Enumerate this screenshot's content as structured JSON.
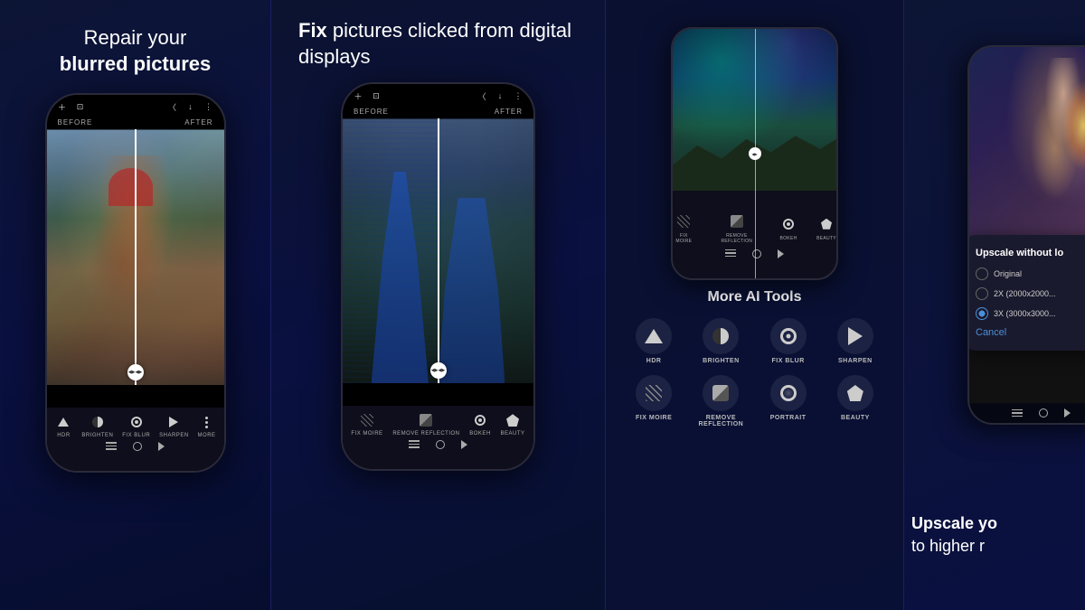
{
  "sections": {
    "section1": {
      "heading_line1": "Repair your",
      "heading_line2": "blurred pictures",
      "before_label": "BEFORE",
      "after_label": "AFTER",
      "tools": [
        "HDR",
        "BRIGHTEN",
        "FIX BLUR",
        "SHARPEN",
        "MORE"
      ]
    },
    "section2": {
      "heading_bold": "Fix",
      "heading_rest": " pictures clicked from digital displays",
      "before_label": "BEFORE",
      "after_label": "AFTER",
      "tools": [
        "FIX MOIRE",
        "REMOVE REFLECTION",
        "BOKEH",
        "BEAUTY"
      ]
    },
    "section3": {
      "phone_tools_top": [
        "FIX MOIRE",
        "REMOVE REFLECTION",
        "BOKEH",
        "BEAUTY"
      ],
      "ai_tools_title": "More AI Tools",
      "tools_row1": [
        "HDR",
        "BRIGHTEN",
        "FIX BLUR",
        "SHARPEN"
      ],
      "tools_row2": [
        "FIX MOIRE",
        "REMOVE REFLECTION",
        "PORTRAIT",
        "BEAUTY"
      ]
    },
    "section4": {
      "heading_line1": "Upscale yo",
      "heading_line2": "to higher r",
      "dialog_title": "Upscale without lo",
      "options": [
        "Original",
        "2X (2000x2000...",
        "3X (3000x3000..."
      ],
      "selected_option": 2,
      "cancel_label": "Cancel"
    }
  }
}
